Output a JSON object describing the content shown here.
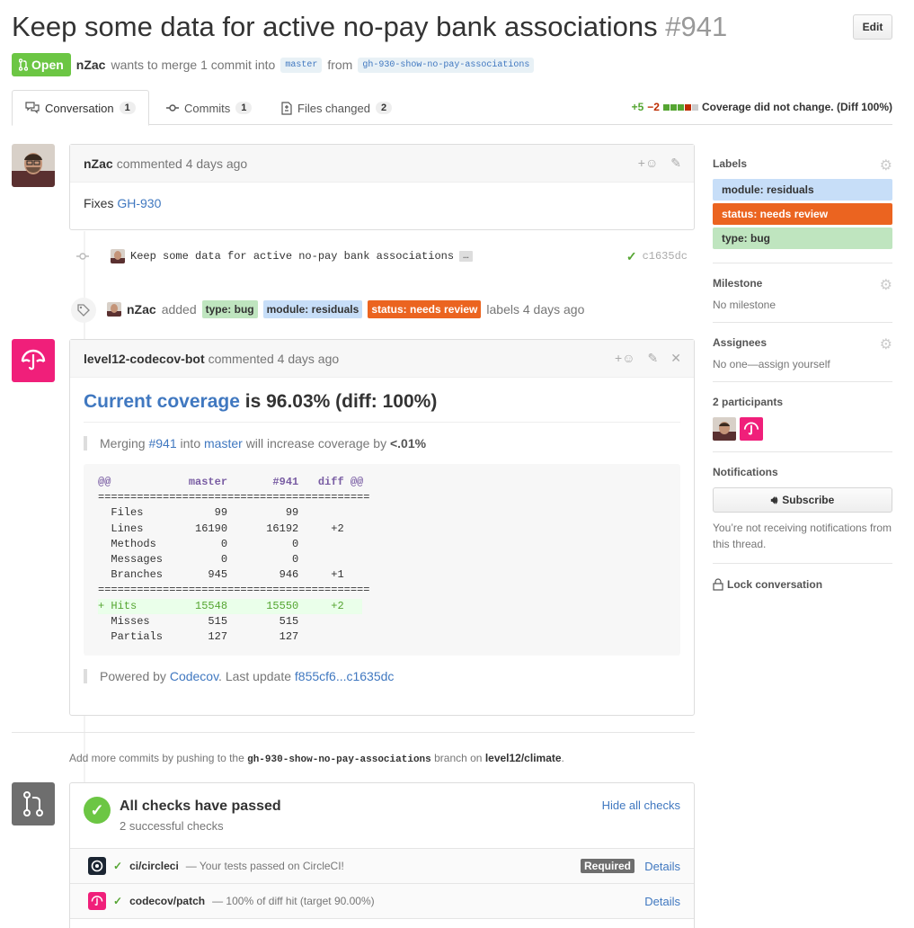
{
  "pr": {
    "title": "Keep some data for active no-pay bank associations",
    "number": "#941",
    "edit_label": "Edit",
    "state": "Open",
    "author": "nZac",
    "merge_text": "wants to merge 1 commit into",
    "base_branch": "master",
    "from_text": "from",
    "head_branch": "gh-930-show-no-pay-associations"
  },
  "tabs": [
    {
      "label": "Conversation",
      "count": "1"
    },
    {
      "label": "Commits",
      "count": "1"
    },
    {
      "label": "Files changed",
      "count": "2"
    }
  ],
  "coverage_status": {
    "additions": "+5",
    "deletions": "−2",
    "text": "Coverage did not change. (Diff 100%)",
    "colors": [
      "#55a532",
      "#55a532",
      "#55a532",
      "#bd2c00",
      "#cccccc"
    ]
  },
  "comment1": {
    "author": "nZac",
    "action": "commented 4 days ago",
    "body_prefix": "Fixes",
    "body_link": "GH-930"
  },
  "commit": {
    "message": "Keep some data for active no-pay bank associations",
    "ellipsis": "…",
    "sha": "c1635dc"
  },
  "label_event": {
    "author": "nZac",
    "action": "added",
    "labels": [
      "type: bug",
      "module: residuals",
      "status: needs review"
    ],
    "suffix": "labels 4 days ago"
  },
  "comment2": {
    "author": "level12-codecov-bot",
    "action": "commented 4 days ago",
    "heading_link": "Current coverage",
    "heading_rest": "is 96.03% (diff: 100%)",
    "quote": {
      "prefix": "Merging",
      "pr_link": "#941",
      "into": "into",
      "branch_link": "master",
      "middle": "will increase coverage by",
      "amount": "<.01%"
    },
    "table_header": "@@            master       #941   diff @@",
    "separator": "==========================================",
    "rows": [
      "  Files           99         99          ",
      "  Lines        16190      16192     +2   ",
      "  Methods          0          0          ",
      "  Messages         0          0          ",
      "  Branches       945        946     +1   "
    ],
    "hits_row": "+ Hits         15548      15550     +2   ",
    "rows_after": [
      "  Misses         515        515          ",
      "  Partials       127        127          "
    ],
    "powered_prefix": "Powered by",
    "powered_link": "Codecov",
    "update_text": ". Last update",
    "update_link": "f855cf6...c1635dc"
  },
  "sidebar": {
    "labels_title": "Labels",
    "labels": [
      {
        "name": "module: residuals",
        "color": "#c7def8",
        "text_color": "#333333"
      },
      {
        "name": "status: needs review",
        "color": "#eb6420",
        "text_color": "#ffffff"
      },
      {
        "name": "type: bug",
        "color": "#bfe5bf",
        "text_color": "#333333"
      }
    ],
    "milestone_title": "Milestone",
    "milestone_value": "No milestone",
    "assignees_title": "Assignees",
    "assignees_value": "No one—assign yourself",
    "participants_title": "2 participants",
    "notifications_title": "Notifications",
    "subscribe_label": "Subscribe",
    "notifications_note": "You’re not receiving notifications from this thread.",
    "lock_label": "Lock conversation"
  },
  "merge": {
    "note_prefix": "Add more commits by pushing to the",
    "note_branch": "gh-930-show-no-pay-associations",
    "note_middle": "branch on",
    "note_repo": "level12/climate",
    "note_end": ".",
    "checks_title": "All checks have passed",
    "checks_sub": "2 successful checks",
    "hide_label": "Hide all checks",
    "checks": [
      {
        "name": "ci/circleci",
        "desc": "— Your tests passed on CircleCI!",
        "required": "Required",
        "details": "Details"
      },
      {
        "name": "codecov/patch",
        "desc": "— 100% of diff hit (target 90.00%)",
        "details": "Details"
      }
    ]
  }
}
